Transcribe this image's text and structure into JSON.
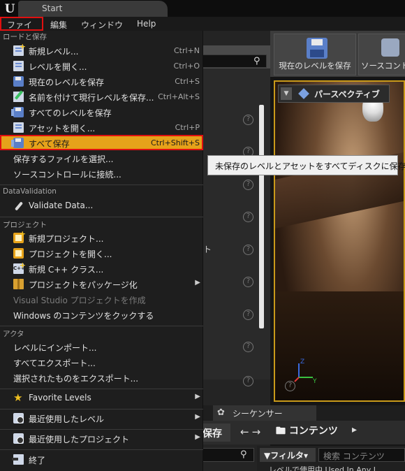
{
  "window": {
    "tab_title": "Start",
    "logo": "U"
  },
  "menubar": {
    "items": [
      {
        "label": "ファイル"
      },
      {
        "label": "編集"
      },
      {
        "label": "ウィンドウ"
      },
      {
        "label": "Help"
      }
    ]
  },
  "file_menu": {
    "sections": {
      "load_save": "ロードと保存",
      "datavalidation": "DataValidation",
      "project": "プロジェクト",
      "actor": "アクタ"
    },
    "items": {
      "new_level": {
        "label": "新規レベル...",
        "shortcut": "Ctrl+N"
      },
      "open_level": {
        "label": "レベルを開く...",
        "shortcut": "Ctrl+O"
      },
      "save_current_level": {
        "label": "現在のレベルを保存",
        "shortcut": "Ctrl+S"
      },
      "save_as": {
        "label": "名前を付けて現行レベルを保存...",
        "shortcut": "Ctrl+Alt+S"
      },
      "save_all_levels": {
        "label": "すべてのレベルを保存"
      },
      "open_asset": {
        "label": "アセットを開く...",
        "shortcut": "Ctrl+P"
      },
      "save_all": {
        "label": "すべて保存",
        "shortcut": "Ctrl+Shift+S"
      },
      "choose_files": {
        "label": "保存するファイルを選択..."
      },
      "source_control": {
        "label": "ソースコントロールに接続..."
      },
      "validate_data": {
        "label": "Validate Data..."
      },
      "new_project": {
        "label": "新規プロジェクト..."
      },
      "open_project": {
        "label": "プロジェクトを開く..."
      },
      "new_cpp_class": {
        "label": "新規 C++ クラス..."
      },
      "package_project": {
        "label": "プロジェクトをパッケージ化"
      },
      "vs_project": {
        "label": "Visual Studio プロジェクトを作成"
      },
      "windows_cook": {
        "label": "Windows のコンテンツをクックする"
      },
      "import_level": {
        "label": "レベルにインポート..."
      },
      "export_all": {
        "label": "すべてエクスポート..."
      },
      "export_selected": {
        "label": "選択されたものをエクスポート..."
      },
      "favorite_levels": {
        "label": "Favorite Levels"
      },
      "recent_levels": {
        "label": "最近使用したレベル"
      },
      "recent_projects": {
        "label": "最近使用したプロジェクト"
      },
      "exit": {
        "label": "終了"
      }
    }
  },
  "tooltip": {
    "text": "未保存のレベルとアセットをすべてディスクに保存"
  },
  "toolbar": {
    "save_current": "現在のレベルを保存",
    "source_control": "ソースコント"
  },
  "viewport": {
    "perspective_label": "パースペクティブ"
  },
  "left_panel": {
    "stray_text": "ト"
  },
  "bottom": {
    "sequencer_tab": "シーケンサー",
    "save_label": "保存",
    "content_label": "コンテンツ",
    "filter_label": "フィルタ",
    "search_placeholder": "検索 コンテンツ",
    "col_headers": "レベルで使用中  Used In Any L"
  },
  "colors": {
    "highlight": "#e6a21a",
    "highlight_border": "#e01010",
    "viewport_border": "#c99a1a"
  }
}
